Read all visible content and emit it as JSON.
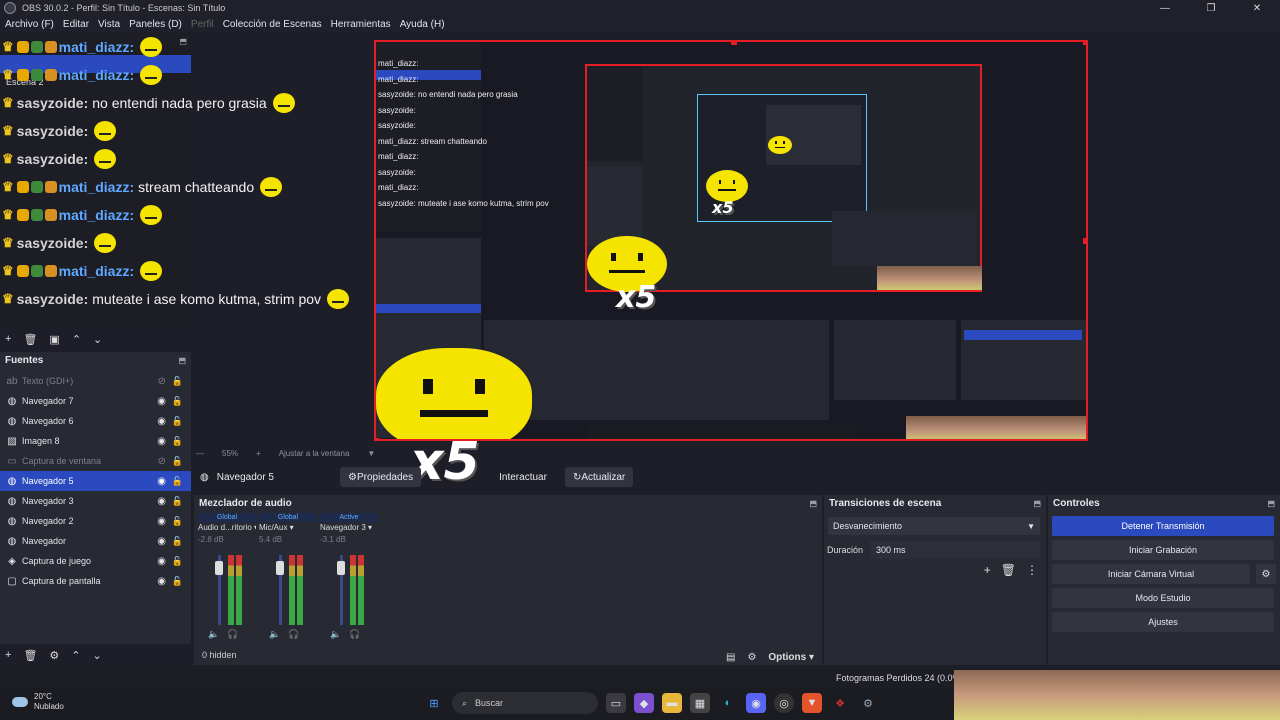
{
  "window": {
    "title": "OBS 30.0.2 - Perfil: Sin Título - Escenas: Sin Título"
  },
  "menu": [
    "Archivo (F)",
    "Editar",
    "Vista",
    "Paneles (D)",
    "Perfil",
    "Colección de Escenas",
    "Herramientas",
    "Ayuda (H)"
  ],
  "scenes": {
    "visible_item": "Escena 2"
  },
  "chat": [
    {
      "user": "mati_diazz",
      "msg": "",
      "kind": "b"
    },
    {
      "user": "mati_diazz",
      "msg": "",
      "kind": "b"
    },
    {
      "user": "sasyzoide",
      "msg": "no entendi nada pero grasia",
      "kind": "g"
    },
    {
      "user": "sasyzoide",
      "msg": "",
      "kind": "g"
    },
    {
      "user": "sasyzoide",
      "msg": "",
      "kind": "g"
    },
    {
      "user": "mati_diazz",
      "msg": "stream chatteando",
      "kind": "b"
    },
    {
      "user": "mati_diazz",
      "msg": "",
      "kind": "b"
    },
    {
      "user": "sasyzoide",
      "msg": "",
      "kind": "g"
    },
    {
      "user": "mati_diazz",
      "msg": "",
      "kind": "b"
    },
    {
      "user": "sasyzoide",
      "msg": "muteate i ase komo kutma, strim pov",
      "kind": "g"
    }
  ],
  "sources": {
    "title": "Fuentes",
    "items": [
      {
        "label": "Texto (GDI+)",
        "icon": "ab",
        "dim": true
      },
      {
        "label": "Navegador 7",
        "icon": "globe"
      },
      {
        "label": "Navegador 6",
        "icon": "globe"
      },
      {
        "label": "Imagen 8",
        "icon": "image"
      },
      {
        "label": "Captura de ventana",
        "icon": "window",
        "dim": true
      },
      {
        "label": "Navegador 5",
        "icon": "globe",
        "selected": true
      },
      {
        "label": "Navegador 3",
        "icon": "globe"
      },
      {
        "label": "Navegador 2",
        "icon": "globe"
      },
      {
        "label": "Navegador",
        "icon": "globe"
      },
      {
        "label": "Captura de juego",
        "icon": "gamepad"
      },
      {
        "label": "Captura de pantalla",
        "icon": "monitor"
      }
    ]
  },
  "preview": {
    "zoom": "55%",
    "fit_label": "Ajustar a la ventana",
    "emote_text": "x5",
    "mini_chat": [
      "mati_diazz:",
      "mati_diazz:",
      "sasyzoide: no entendi nada pero grasia",
      "sasyzoide:",
      "sasyzoide:",
      "mati_diazz: stream chatteando",
      "mati_diazz:",
      "sasyzoide:",
      "mati_diazz:",
      "sasyzoide: muteate i ase komo kutma, strim pov"
    ]
  },
  "context_bar": {
    "source_name": "Navegador 5",
    "properties": "Propiedades",
    "interact": "Interactuar",
    "refresh": "Actualizar"
  },
  "mixer": {
    "title": "Mezclador de audio",
    "channels": [
      {
        "head": "Global",
        "name": "Audio d...ritorio",
        "db": "-2.8 dB"
      },
      {
        "head": "Global",
        "name": "Mic/Aux",
        "db": "5.4 dB"
      },
      {
        "head": "Active",
        "name": "Navegador 3",
        "db": "-3.1 dB"
      }
    ],
    "hidden": "0 hidden",
    "options": "Options"
  },
  "transitions": {
    "title": "Transiciones de escena",
    "selected": "Desvanecimiento",
    "duration_label": "Duración",
    "duration_value": "300 ms"
  },
  "controls": {
    "title": "Controles",
    "stop_stream": "Detener Transmisión",
    "start_record": "Iniciar Grabación",
    "virtual_cam": "Iniciar Cámara Virtual",
    "studio_mode": "Modo Estudio",
    "settings": "Ajustes"
  },
  "status": {
    "dropped": "Fotogramas Perdidos 24 (0.0%)"
  },
  "taskbar": {
    "temp": "20°C",
    "weather": "Nublado",
    "search": "Buscar"
  }
}
